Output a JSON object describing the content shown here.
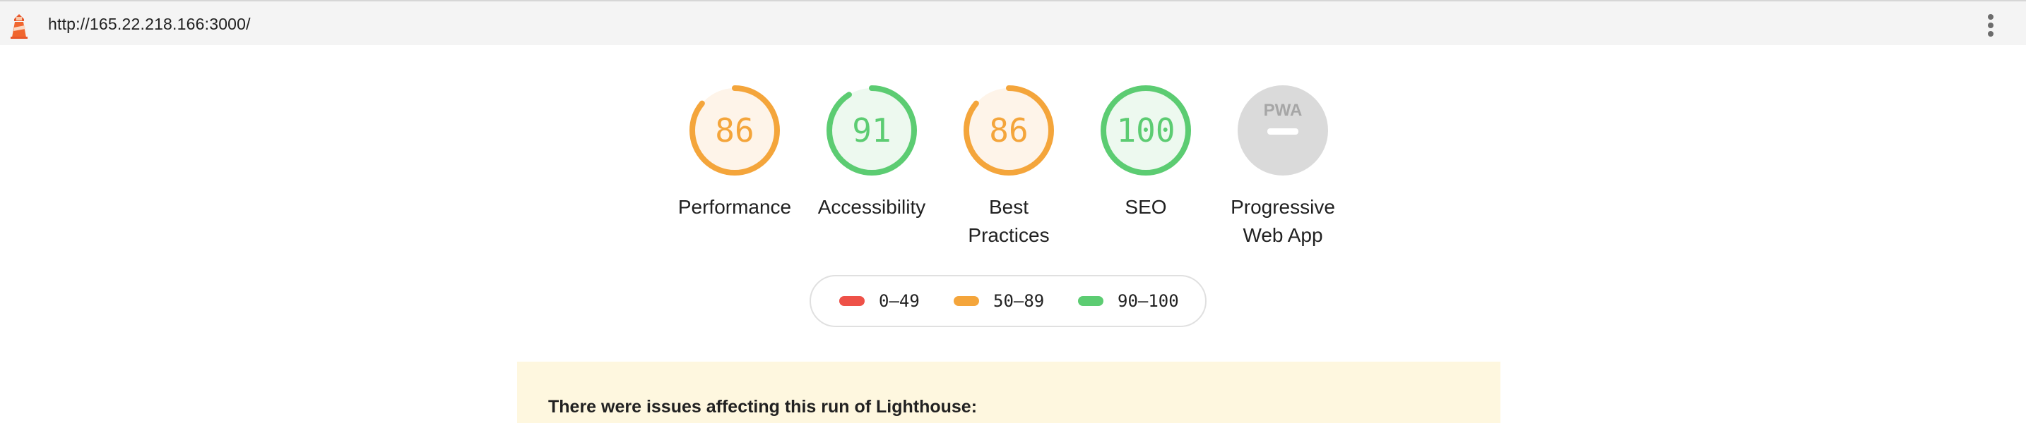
{
  "topbar": {
    "url": "http://165.22.218.166:3000/",
    "logo_icon": "lighthouse-icon",
    "menu_icon": "kebab-menu-icon"
  },
  "gauges": [
    {
      "id": "performance",
      "score": "86",
      "value": 86,
      "label_lines": [
        "Performance"
      ],
      "color": "#f4a53b",
      "fill": "#fef4e9"
    },
    {
      "id": "accessibility",
      "score": "91",
      "value": 91,
      "label_lines": [
        "Accessibility"
      ],
      "color": "#5ccc72",
      "fill": "#edf9ef"
    },
    {
      "id": "best-practices",
      "score": "86",
      "value": 86,
      "label_lines": [
        "Best",
        "Practices"
      ],
      "color": "#f4a53b",
      "fill": "#fef4e9"
    },
    {
      "id": "seo",
      "score": "100",
      "value": 100,
      "label_lines": [
        "SEO"
      ],
      "color": "#5ccc72",
      "fill": "#edf9ef"
    },
    {
      "id": "pwa",
      "badge_text": "PWA",
      "label_lines": [
        "Progressive",
        "Web App"
      ],
      "color": "#d9d9d9",
      "icon": "pwa-badge-icon"
    }
  ],
  "legend": [
    {
      "range": "0–49",
      "color": "#ee5148"
    },
    {
      "range": "50–89",
      "color": "#f4a53b"
    },
    {
      "range": "90–100",
      "color": "#5ccc72"
    }
  ],
  "warning": {
    "text": "There were issues affecting this run of Lighthouse:"
  }
}
